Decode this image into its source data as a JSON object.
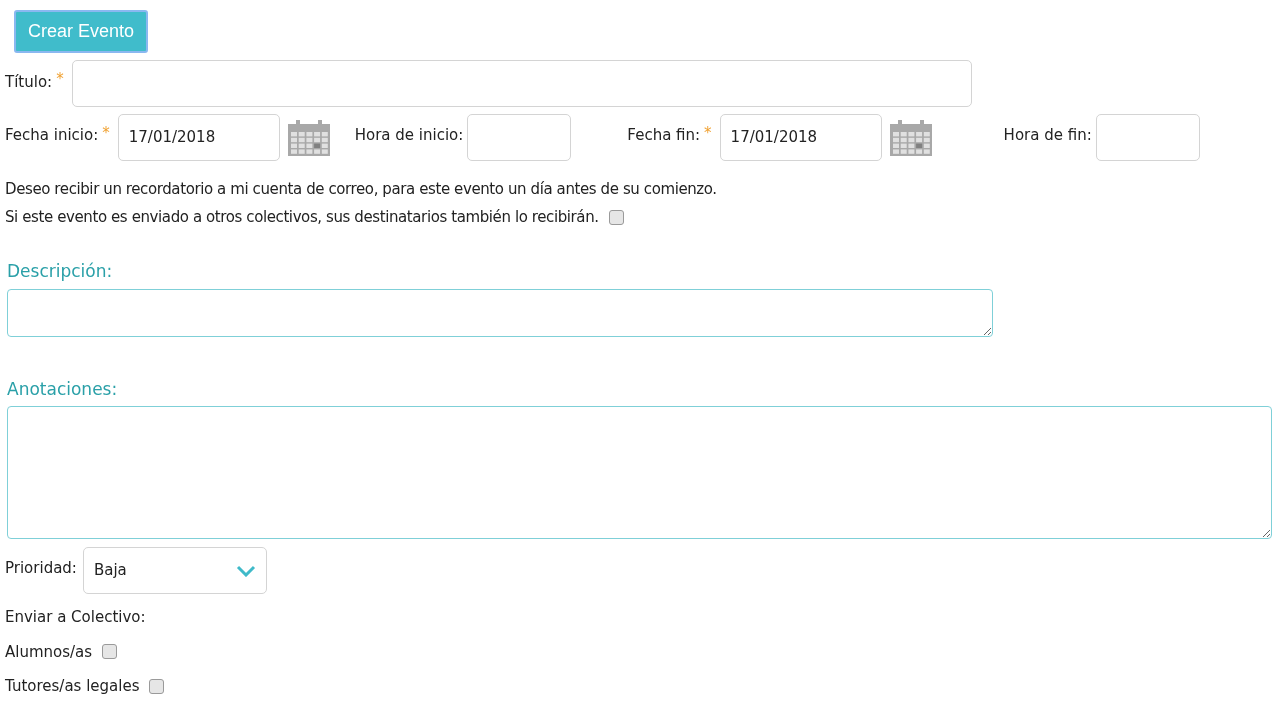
{
  "create_button": "Crear Evento",
  "title_field": {
    "label": "Título:",
    "required_mark": "*"
  },
  "date_row": [
    {
      "kind": "date",
      "label": "Fecha inicio:",
      "required_mark": "*",
      "value": "17/01/2018"
    },
    {
      "kind": "time",
      "label": "Hora de inicio:"
    },
    {
      "kind": "date",
      "label": "Fecha fin:",
      "required_mark": "*",
      "value": "17/01/2018"
    },
    {
      "kind": "time",
      "label": "Hora de fin:"
    }
  ],
  "reminder": {
    "line_1": "Deseo recibir un recordatorio a mi cuenta de correo, para este evento un día antes de su comienzo.",
    "line_2": "Si este evento es enviado a otros colectivos, sus destinatarios también lo recibirán.",
    "checked": false
  },
  "description": {
    "label": "Descripción:"
  },
  "notes": {
    "label": "Anotaciones:"
  },
  "priority": {
    "label": "Prioridad:",
    "value": "Baja"
  },
  "send_to": {
    "label": "Enviar a Colectivo:",
    "options": [
      {
        "label": "Alumnos/as",
        "checked": false
      },
      {
        "label": "Tutores/as legales",
        "checked": false
      }
    ]
  }
}
